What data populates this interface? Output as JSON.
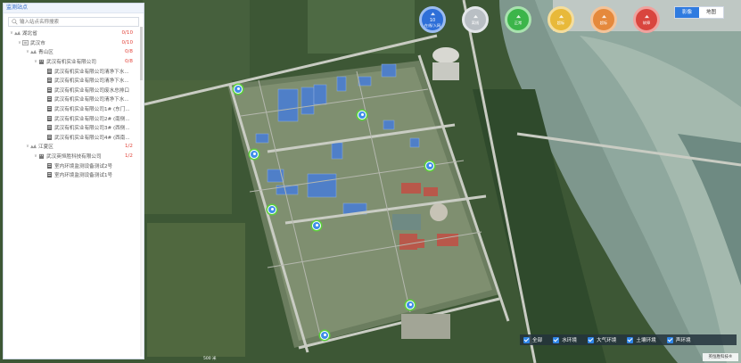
{
  "panel": {
    "title": "监测站点",
    "search_placeholder": "输入站点名称搜索"
  },
  "tree": [
    {
      "level": 0,
      "arrow": "∨",
      "icon": "org-icon",
      "label": "湖北省",
      "count": "0/10"
    },
    {
      "level": 1,
      "arrow": "∨",
      "icon": "city-icon",
      "label": "武汉市",
      "count": "0/10"
    },
    {
      "level": 2,
      "arrow": "∨",
      "icon": "org-icon",
      "label": "青山区",
      "count": "0/8"
    },
    {
      "level": 3,
      "arrow": "∨",
      "icon": "company-icon",
      "label": "武汉有机实业有限公司",
      "count": "0/8"
    },
    {
      "level": 4,
      "arrow": "",
      "icon": "station-icon",
      "label": "武汉有机实业有限公司清净下水..."
    },
    {
      "level": 4,
      "arrow": "",
      "icon": "station-icon",
      "label": "武汉有机实业有限公司清净下水..."
    },
    {
      "level": 4,
      "arrow": "",
      "icon": "station-icon",
      "label": "武汉有机实业有限公司废水总排口"
    },
    {
      "level": 4,
      "arrow": "",
      "icon": "station-icon",
      "label": "武汉有机实业有限公司清净下水..."
    },
    {
      "level": 4,
      "arrow": "",
      "icon": "station-icon",
      "label": "武汉有机实业有限公司1# (东门..."
    },
    {
      "level": 4,
      "arrow": "",
      "icon": "station-icon",
      "label": "武汉有机实业有限公司2# (南侧..."
    },
    {
      "level": 4,
      "arrow": "",
      "icon": "station-icon",
      "label": "武汉有机实业有限公司3# (西侧..."
    },
    {
      "level": 4,
      "arrow": "",
      "icon": "station-icon",
      "label": "武汉有机实业有限公司4# (西南..."
    },
    {
      "level": 2,
      "arrow": "∨",
      "icon": "org-icon",
      "label": "江夏区",
      "count": "1/2"
    },
    {
      "level": 3,
      "arrow": "∨",
      "icon": "company-icon",
      "label": "武汉英恒胜科技有限公司",
      "count": "1/2"
    },
    {
      "level": 4,
      "arrow": "",
      "icon": "station-icon",
      "label": "室内环境监测设备测试2号"
    },
    {
      "level": 4,
      "arrow": "",
      "icon": "station-icon",
      "label": "室内环境监测设备测试1号"
    }
  ],
  "status_circles": [
    {
      "count": "10",
      "label": "在线/入网",
      "color": "#2e6fd8",
      "ring": "#9bbcf0"
    },
    {
      "count": "",
      "label": "离线",
      "color": "#b9bfc4",
      "ring": "#e4e7ea"
    },
    {
      "count": "",
      "label": "正常",
      "color": "#3cb54a",
      "ring": "#a8e2ae"
    },
    {
      "count": "",
      "label": "超标",
      "color": "#e8b93a",
      "ring": "#f4dd9c"
    },
    {
      "count": "",
      "label": "超标",
      "color": "#e5893c",
      "ring": "#f3c49a"
    },
    {
      "count": "",
      "label": "故障",
      "color": "#d9453e",
      "ring": "#f0a29e"
    }
  ],
  "map_switch": {
    "image": "影像",
    "map": "地图"
  },
  "filters": [
    {
      "label": "全部"
    },
    {
      "label": "水环境"
    },
    {
      "label": "大气环境"
    },
    {
      "label": "土壤环境"
    },
    {
      "label": "声环境"
    }
  ],
  "copyright": "英恒胜科技®",
  "scale_text": "500 米",
  "colors": {
    "accent": "#2f7be0",
    "alarm": "#e2453b"
  }
}
